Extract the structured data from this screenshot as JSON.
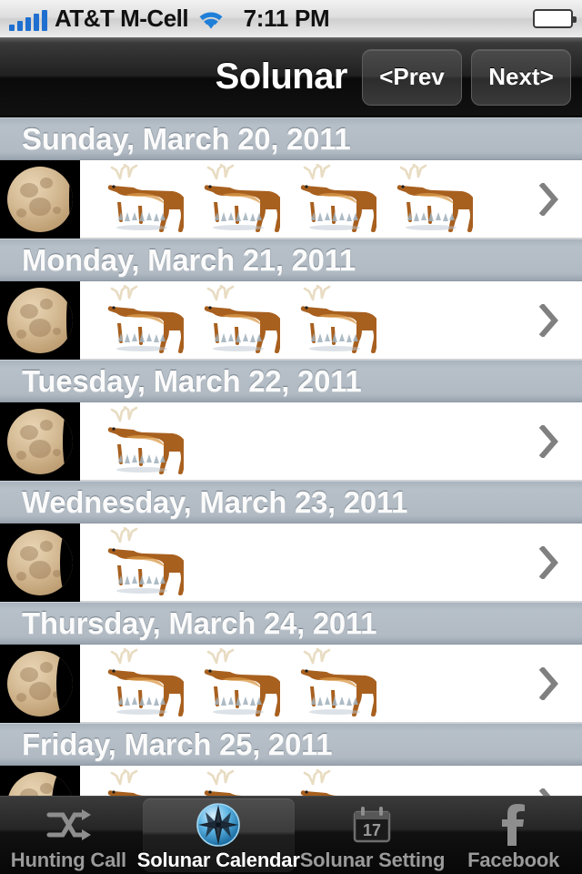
{
  "status_bar": {
    "signal_icon": "signal-bars-icon",
    "carrier": "AT&T M-Cell",
    "wifi_icon": "wifi-icon",
    "time": "7:11 PM",
    "battery_icon": "battery-full-icon"
  },
  "nav": {
    "title": "Solunar",
    "prev_label": "<Prev",
    "next_label": "Next>"
  },
  "colors": {
    "nav_bg": "#111111",
    "section_header": "#b1bac3",
    "row_bg": "#ffffff",
    "chevron": "#808080",
    "moon_disc": "#c2a378",
    "deer": "#a8601f",
    "tab_selected_text": "#ffffff",
    "tab_text": "#9a9a9a",
    "signal_bars": "#1f6fd0",
    "battery_fill": "#5fc62c"
  },
  "list": {
    "sections": [
      {
        "header": "Sunday, March 20, 2011",
        "moon_icon": "moon-phase-icon",
        "moon_phase": "full",
        "moon_shadow_pct": 3,
        "rating": 4,
        "chevron_icon": "disclosure-chevron-icon"
      },
      {
        "header": "Monday, March 21, 2011",
        "moon_icon": "moon-phase-icon",
        "moon_phase": "waning-gibbous",
        "moon_shadow_pct": 8,
        "rating": 3,
        "chevron_icon": "disclosure-chevron-icon"
      },
      {
        "header": "Tuesday, March 22, 2011",
        "moon_icon": "moon-phase-icon",
        "moon_phase": "waning-gibbous",
        "moon_shadow_pct": 14,
        "rating": 1,
        "chevron_icon": "disclosure-chevron-icon"
      },
      {
        "header": "Wednesday, March 23, 2011",
        "moon_icon": "moon-phase-icon",
        "moon_phase": "waning-gibbous",
        "moon_shadow_pct": 20,
        "rating": 1,
        "chevron_icon": "disclosure-chevron-icon"
      },
      {
        "header": "Thursday, March 24, 2011",
        "moon_icon": "moon-phase-icon",
        "moon_phase": "waning-gibbous",
        "moon_shadow_pct": 26,
        "rating": 3,
        "chevron_icon": "disclosure-chevron-icon"
      },
      {
        "header": "Friday, March 25, 2011",
        "moon_icon": "moon-phase-icon",
        "moon_phase": "waning-gibbous",
        "moon_shadow_pct": 34,
        "rating": 3,
        "chevron_icon": "disclosure-chevron-icon"
      }
    ]
  },
  "tabbar": {
    "items": [
      {
        "label": "Hunting Call",
        "icon": "shuffle-icon",
        "selected": false
      },
      {
        "label": "Solunar Calendar",
        "icon": "compass-rose-icon",
        "selected": true
      },
      {
        "label": "Solunar Setting",
        "icon": "calendar-17-icon",
        "selected": false
      },
      {
        "label": "Facebook",
        "icon": "facebook-f-icon",
        "selected": false
      }
    ]
  }
}
